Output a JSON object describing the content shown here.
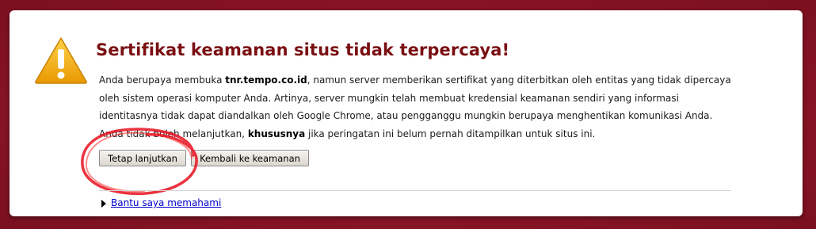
{
  "page": {
    "title": "Sertifikat keamanan situs tidak terpercaya!",
    "body": {
      "p1": "Anda berupaya membuka ",
      "domain": "tnr.tempo.co.id",
      "p2": ", namun server memberikan sertifikat yang diterbitkan oleh entitas yang tidak dipercaya oleh sistem operasi komputer Anda. Artinya, server mungkin telah membuat kredensial keamanan sendiri yang informasi identitasnya tidak dapat diandalkan oleh Google Chrome, atau pengganggu mungkin berupaya menghentikan komunikasi Anda. Anda tidak boleh melanjutkan, ",
      "emphasis": "khususnya",
      "p3": " jika peringatan ini belum pernah ditampilkan untuk situs ini."
    },
    "buttons": {
      "proceed": "Tetap lanjutkan",
      "back": "Kembali ke keamanan"
    },
    "help_link": "Bantu saya memahami"
  },
  "colors": {
    "background": "#8b1a2a",
    "title": "#7a0f12",
    "warning_icon": "#f0a800",
    "annotation": "#e8101e",
    "link": "#0000cc"
  },
  "icons": {
    "warning": "warning-triangle-icon",
    "expand": "expand-arrow-icon"
  }
}
